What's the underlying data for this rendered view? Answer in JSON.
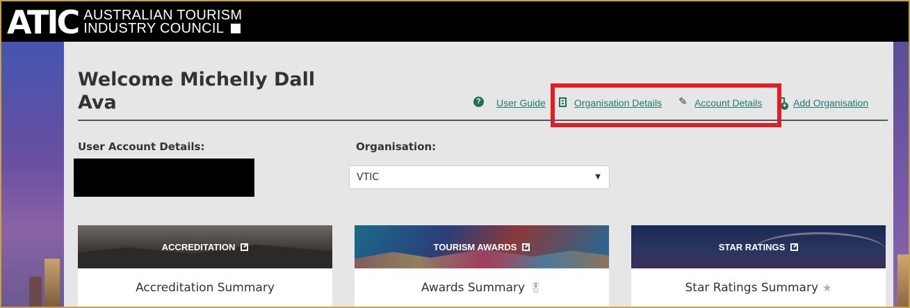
{
  "brand": {
    "mark": "ATIC",
    "line1": "AUSTRALIAN TOURISM",
    "line2": "INDUSTRY COUNCIL"
  },
  "welcome": {
    "line1": "Welcome Michelly Dall",
    "line2": "Ava"
  },
  "links": {
    "user_guide": "User Guide",
    "organisation_details": "Organisation Details",
    "account_details": "Account Details",
    "add_organisation": "Add Organisation"
  },
  "user_account": {
    "label": "User Account Details:"
  },
  "organisation": {
    "label": "Organisation:",
    "selected": "VTIC"
  },
  "cards": [
    {
      "banner": "ACCREDITATION",
      "title": "Accreditation Summary",
      "icon": "none"
    },
    {
      "banner": "TOURISM AWARDS",
      "title": "Awards Summary",
      "icon": "award-icon"
    },
    {
      "banner": "STAR RATINGS",
      "title": "Star Ratings Summary",
      "icon": "star-icon"
    }
  ],
  "colors": {
    "link": "#1e7b73",
    "highlight": "#e51c23",
    "header": "#000000",
    "panel": "#e6e6e6"
  }
}
